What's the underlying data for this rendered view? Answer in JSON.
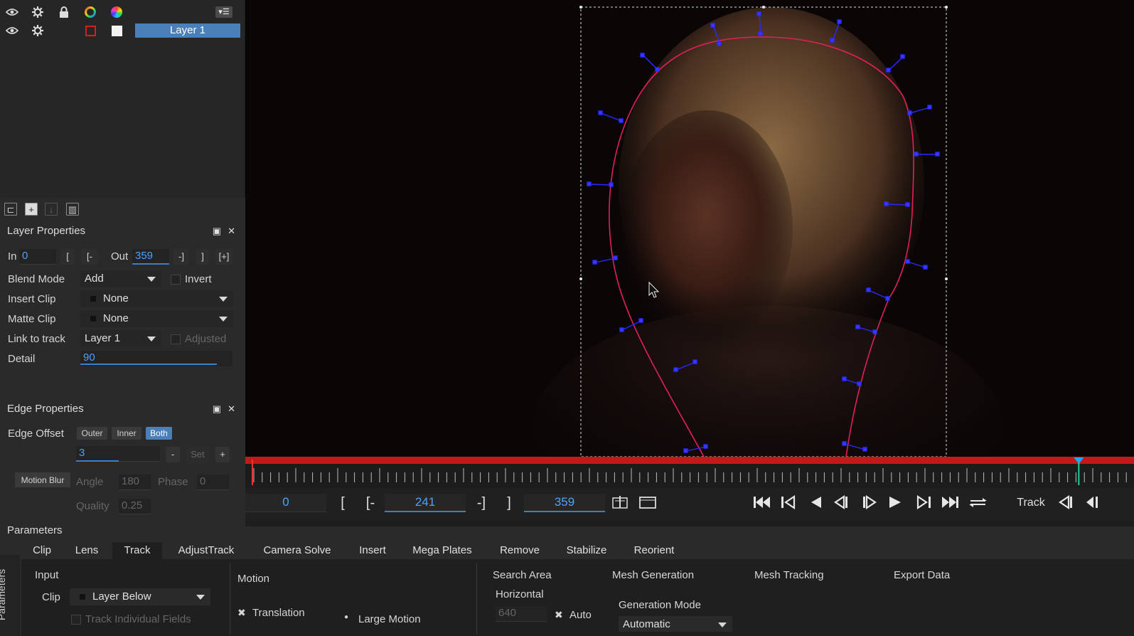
{
  "layers_panel": {
    "layers": [
      {
        "name": "Layer 1",
        "color": "#cc2222"
      }
    ],
    "header_icons": [
      "eye-icon",
      "gear-icon",
      "lock-icon",
      "color-ring-icon",
      "color-wheel-icon",
      "panel-menu-icon"
    ],
    "tools": [
      "new-folder-icon",
      "add-layer-icon",
      "import-icon",
      "trash-icon"
    ]
  },
  "layer_properties": {
    "title": "Layer Properties",
    "in_label": "In",
    "in_value": "0",
    "in_btns": [
      "[",
      "[-"
    ],
    "out_label": "Out",
    "out_value": "359",
    "out_btns": [
      "-]",
      "]",
      "[+]"
    ],
    "blend_mode_label": "Blend Mode",
    "blend_mode_value": "Add",
    "invert_label": "Invert",
    "insert_clip_label": "Insert Clip",
    "insert_clip_value": "None",
    "matte_clip_label": "Matte Clip",
    "matte_clip_value": "None",
    "link_label": "Link to track",
    "link_value": "Layer 1",
    "adjusted_label": "Adjusted",
    "detail_label": "Detail",
    "detail_value": "90"
  },
  "edge_properties": {
    "title": "Edge Properties",
    "offset_label": "Edge Offset",
    "modes": [
      "Outer",
      "Inner",
      "Both"
    ],
    "active_mode": "Both",
    "offset_value": "3",
    "minus": "-",
    "set": "Set",
    "plus": "+",
    "motion_blur": "Motion Blur",
    "angle_label": "Angle",
    "angle_value": "180",
    "phase_label": "Phase",
    "phase_value": "0",
    "quality_label": "Quality",
    "quality_value": "0.25"
  },
  "transport": {
    "current_frame": "0",
    "mark_in": "[",
    "go_in": "[-",
    "in_frame": "241",
    "go_out": "-]",
    "mark_out": "]",
    "out_frame": "359",
    "track_label": "Track",
    "timeline_progress": 0.945
  },
  "parameters": {
    "title": "Parameters",
    "side_label": "Parameters",
    "tabs": [
      "Clip",
      "Lens",
      "Track",
      "AdjustTrack",
      "Camera Solve",
      "Insert",
      "Mega Plates",
      "Remove",
      "Stabilize",
      "Reorient"
    ],
    "active_tab": "Track",
    "input_label": "Input",
    "clip_label": "Clip",
    "clip_value": "Layer Below",
    "track_fields": "Track Individual Fields",
    "motion_label": "Motion",
    "translation": "Translation",
    "large_motion": "Large Motion",
    "search_area": "Search Area",
    "horizontal": "Horizontal",
    "horizontal_value": "640",
    "auto": "Auto",
    "mesh_generation": "Mesh Generation",
    "generation_mode": "Generation Mode",
    "generation_mode_value": "Automatic",
    "mesh_tracking": "Mesh Tracking",
    "export_data": "Export Data"
  },
  "colors": {
    "accent": "#4a7fb8",
    "field_text": "#4aa3ff",
    "spline": "#e0205a",
    "control_point": "#2a2aff",
    "timeline_bar": "#c21a1a"
  }
}
